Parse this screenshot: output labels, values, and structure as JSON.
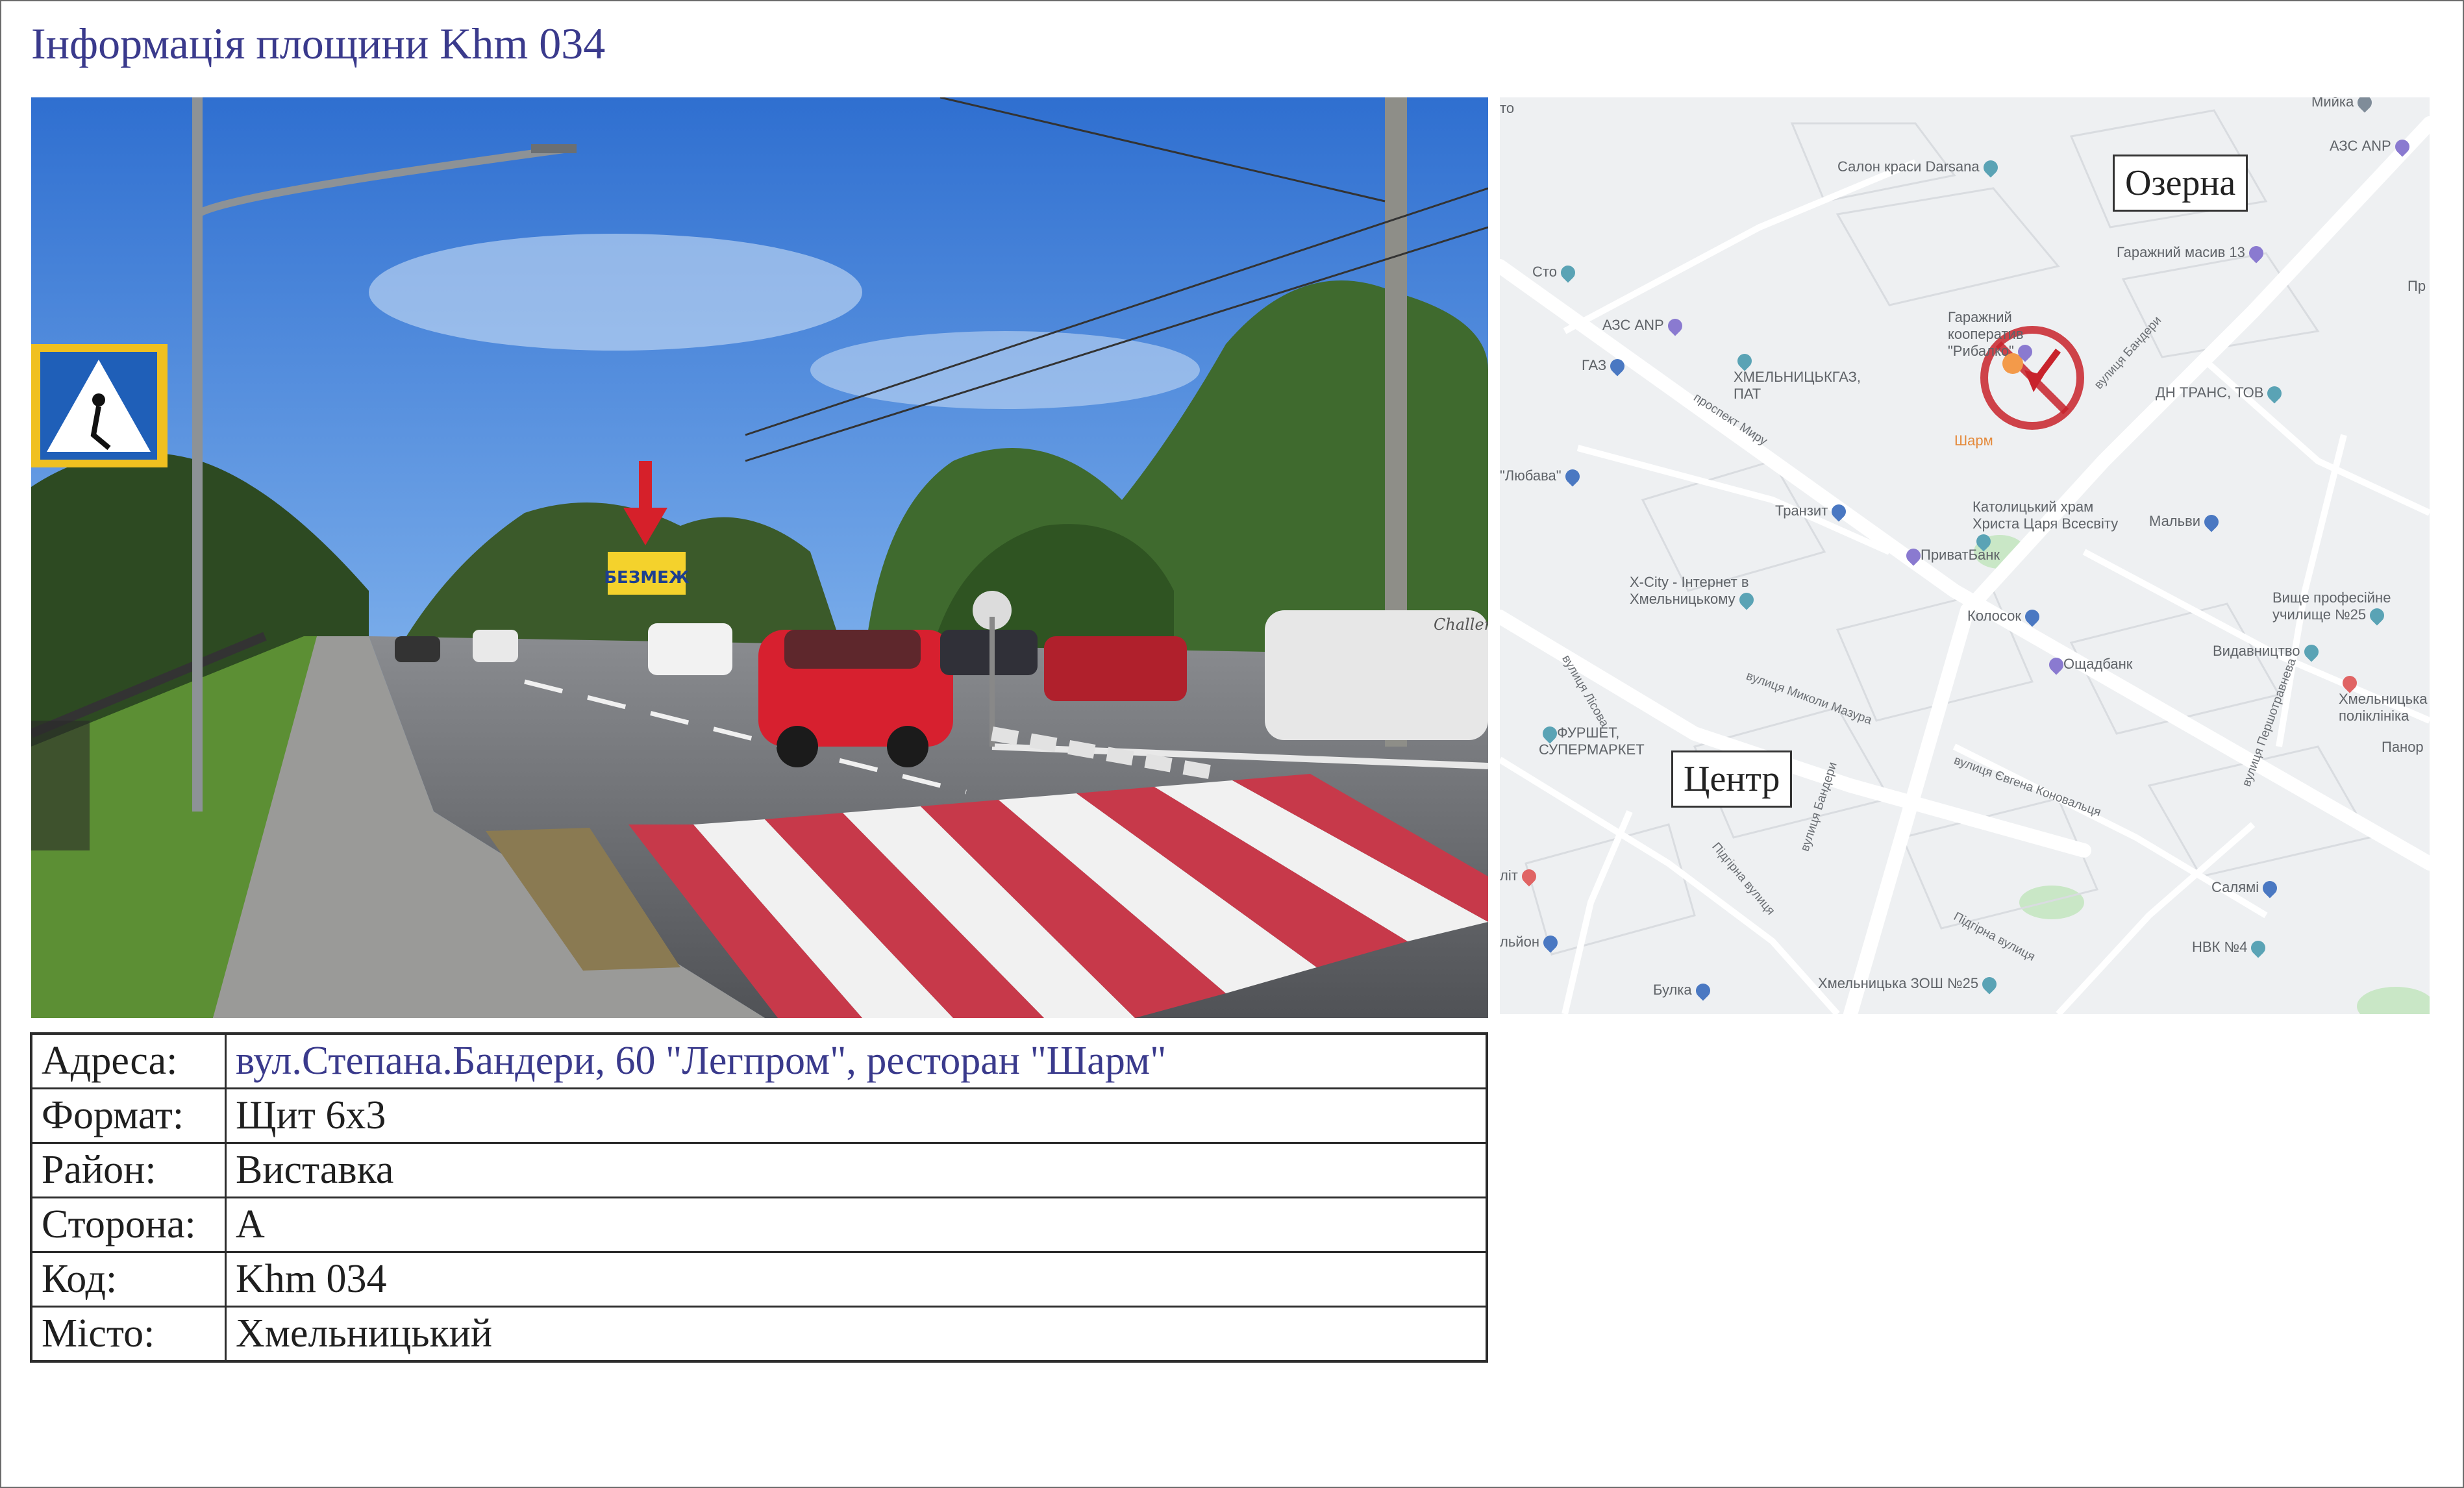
{
  "title": "Інформація площини Khm 034",
  "photo": {
    "billboard_text": "БЕЗМЕЖ",
    "van_brand": "Challenger"
  },
  "map": {
    "callouts": {
      "north": "Озерна",
      "center": "Центр"
    },
    "places": [
      {
        "name": "Мийка",
        "pin": "gray"
      },
      {
        "name": "АЗС ANP",
        "pin": "purple"
      },
      {
        "name": "Салон краси Darsana",
        "pin": "teal"
      },
      {
        "name": "Гаражний масив 13",
        "pin": "purple"
      },
      {
        "name": "Сто",
        "pin": "teal"
      },
      {
        "name": "АЗС ANP",
        "pin": "purple"
      },
      {
        "name": "Гаражний кооператив \"Рибалко\"",
        "pin": "purple"
      },
      {
        "name": "ГАЗ",
        "pin": "blue"
      },
      {
        "name": "ХМЕЛЬНИЦЬКГАЗ, ПАТ",
        "pin": "teal"
      },
      {
        "name": "ДН ТРАНС, ТОВ",
        "pin": "teal"
      },
      {
        "name": "Шарм",
        "pin": "orange"
      },
      {
        "name": "\"Любава\"",
        "pin": "blue"
      },
      {
        "name": "Транзит",
        "pin": "blue"
      },
      {
        "name": "Католицький храм Христа Царя Всесвіту",
        "pin": "teal"
      },
      {
        "name": "Мальви",
        "pin": "blue"
      },
      {
        "name": "ПриватБанк",
        "pin": "purple"
      },
      {
        "name": "X-City - Інтернет в Хмельницькому",
        "pin": "teal"
      },
      {
        "name": "Колосок",
        "pin": "blue"
      },
      {
        "name": "Вище професійне училище №25",
        "pin": "teal"
      },
      {
        "name": "Видавництво",
        "pin": "teal"
      },
      {
        "name": "Ощадбанк",
        "pin": "purple"
      },
      {
        "name": "Хмельницька поліклініка",
        "pin": "red"
      },
      {
        "name": "ФУРШЕТ, СУПЕРМАРКЕТ",
        "pin": "teal"
      },
      {
        "name": "Панор",
        "pin": "none"
      },
      {
        "name": "Салямі",
        "pin": "blue"
      },
      {
        "name": "НВК №4",
        "pin": "teal"
      },
      {
        "name": "Хмельницька ЗОШ №25",
        "pin": "teal"
      },
      {
        "name": "Булка",
        "pin": "blue"
      },
      {
        "name": "льйон",
        "pin": "blue"
      },
      {
        "name": "літ",
        "pin": "red"
      },
      {
        "name": "то",
        "pin": "none"
      },
      {
        "name": "Пр",
        "pin": "none"
      }
    ],
    "streets": [
      "проспект Миру",
      "вулиця Бандери",
      "вулиця Лісова",
      "вулиця Миколи Мазура",
      "вулиця Бандери",
      "вулиця Євгена Коновальця",
      "Підгірна вулиця",
      "Підгірна вулиця",
      "вулиця Першотравнева"
    ],
    "marker_icon": "no-entry-arrow-icon"
  },
  "info": {
    "rows": [
      {
        "key": "Адреса:",
        "value": "вул.Степана.Бандери, 60  \"Легпром\", ресторан \"Шарм\""
      },
      {
        "key": "Формат:",
        "value": "Щит 6х3"
      },
      {
        "key": "Район:",
        "value": "Виставка"
      },
      {
        "key": "Сторона:",
        "value": "А"
      },
      {
        "key": "Код:",
        "value": "Khm 034"
      },
      {
        "key": "Місто:",
        "value": "Хмельницький"
      }
    ]
  }
}
